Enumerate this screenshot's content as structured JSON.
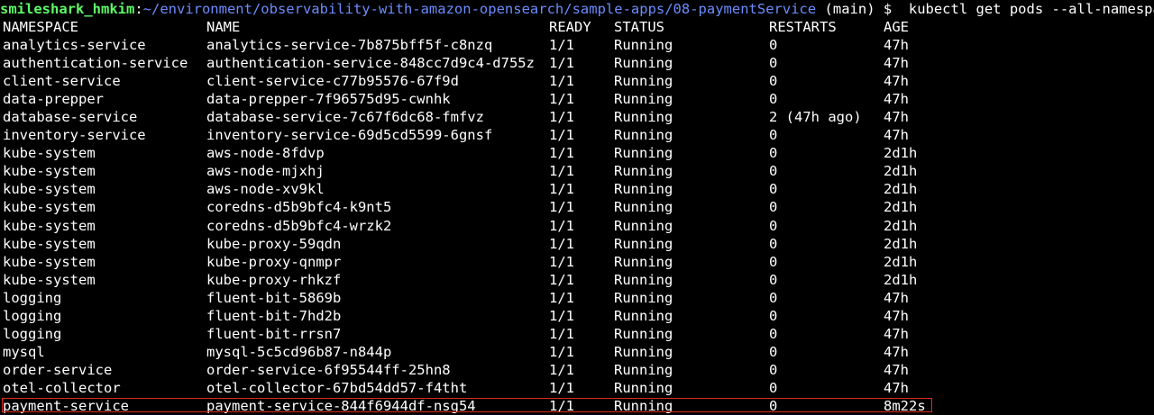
{
  "prompt": {
    "user_host": "smileshark_hmkim",
    "separator": ":",
    "path": "~/environment/observability-with-amazon-opensearch/sample-apps/08-paymentService",
    "branch": " (main) $  ",
    "command": "kubectl get pods --all-namespaces"
  },
  "table": {
    "headers": {
      "namespace": "NAMESPACE",
      "name": "NAME",
      "ready": "READY",
      "status": "STATUS",
      "restarts": "RESTARTS",
      "age": "AGE"
    },
    "rows": [
      {
        "namespace": "analytics-service",
        "name": "analytics-service-7b875bff5f-c8nzq",
        "ready": "1/1",
        "status": "Running",
        "restarts": "0",
        "age": "47h"
      },
      {
        "namespace": "authentication-service",
        "name": "authentication-service-848cc7d9c4-d755z",
        "ready": "1/1",
        "status": "Running",
        "restarts": "0",
        "age": "47h"
      },
      {
        "namespace": "client-service",
        "name": "client-service-c77b95576-67f9d",
        "ready": "1/1",
        "status": "Running",
        "restarts": "0",
        "age": "47h"
      },
      {
        "namespace": "data-prepper",
        "name": "data-prepper-7f96575d95-cwnhk",
        "ready": "1/1",
        "status": "Running",
        "restarts": "0",
        "age": "47h"
      },
      {
        "namespace": "database-service",
        "name": "database-service-7c67f6dc68-fmfvz",
        "ready": "1/1",
        "status": "Running",
        "restarts": "2 (47h ago)",
        "age": "47h"
      },
      {
        "namespace": "inventory-service",
        "name": "inventory-service-69d5cd5599-6gnsf",
        "ready": "1/1",
        "status": "Running",
        "restarts": "0",
        "age": "47h"
      },
      {
        "namespace": "kube-system",
        "name": "aws-node-8fdvp",
        "ready": "1/1",
        "status": "Running",
        "restarts": "0",
        "age": "2d1h"
      },
      {
        "namespace": "kube-system",
        "name": "aws-node-mjxhj",
        "ready": "1/1",
        "status": "Running",
        "restarts": "0",
        "age": "2d1h"
      },
      {
        "namespace": "kube-system",
        "name": "aws-node-xv9kl",
        "ready": "1/1",
        "status": "Running",
        "restarts": "0",
        "age": "2d1h"
      },
      {
        "namespace": "kube-system",
        "name": "coredns-d5b9bfc4-k9nt5",
        "ready": "1/1",
        "status": "Running",
        "restarts": "0",
        "age": "2d1h"
      },
      {
        "namespace": "kube-system",
        "name": "coredns-d5b9bfc4-wrzk2",
        "ready": "1/1",
        "status": "Running",
        "restarts": "0",
        "age": "2d1h"
      },
      {
        "namespace": "kube-system",
        "name": "kube-proxy-59qdn",
        "ready": "1/1",
        "status": "Running",
        "restarts": "0",
        "age": "2d1h"
      },
      {
        "namespace": "kube-system",
        "name": "kube-proxy-qnmpr",
        "ready": "1/1",
        "status": "Running",
        "restarts": "0",
        "age": "2d1h"
      },
      {
        "namespace": "kube-system",
        "name": "kube-proxy-rhkzf",
        "ready": "1/1",
        "status": "Running",
        "restarts": "0",
        "age": "2d1h"
      },
      {
        "namespace": "logging",
        "name": "fluent-bit-5869b",
        "ready": "1/1",
        "status": "Running",
        "restarts": "0",
        "age": "47h"
      },
      {
        "namespace": "logging",
        "name": "fluent-bit-7hd2b",
        "ready": "1/1",
        "status": "Running",
        "restarts": "0",
        "age": "47h"
      },
      {
        "namespace": "logging",
        "name": "fluent-bit-rrsn7",
        "ready": "1/1",
        "status": "Running",
        "restarts": "0",
        "age": "47h"
      },
      {
        "namespace": "mysql",
        "name": "mysql-5c5cd96b87-n844p",
        "ready": "1/1",
        "status": "Running",
        "restarts": "0",
        "age": "47h"
      },
      {
        "namespace": "order-service",
        "name": "order-service-6f95544ff-25hn8",
        "ready": "1/1",
        "status": "Running",
        "restarts": "0",
        "age": "47h"
      },
      {
        "namespace": "otel-collector",
        "name": "otel-collector-67bd54dd57-f4tht",
        "ready": "1/1",
        "status": "Running",
        "restarts": "0",
        "age": "47h"
      },
      {
        "namespace": "payment-service",
        "name": "payment-service-844f6944df-nsg54",
        "ready": "1/1",
        "status": "Running",
        "restarts": "0",
        "age": "8m22s"
      }
    ]
  },
  "colors": {
    "background": "#000000",
    "text": "#ffffff",
    "user_host": "#5ff967",
    "path": "#6b8dff",
    "highlight": "#e0291e"
  }
}
